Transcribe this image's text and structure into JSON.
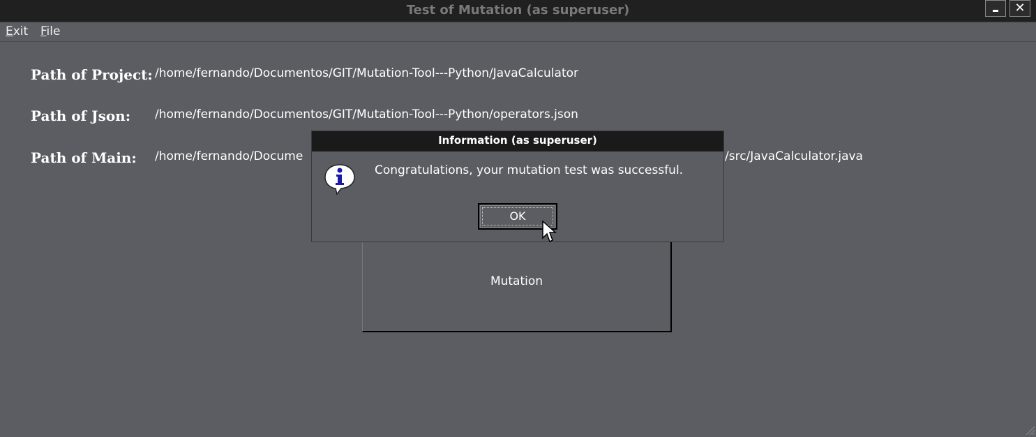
{
  "window": {
    "title": "Test of Mutation (as superuser)",
    "controls": {
      "minimize_icon": "minimize-icon",
      "close_label": "✕"
    }
  },
  "menubar": {
    "items": [
      {
        "label": "Exit",
        "mnemonic": "E"
      },
      {
        "label": "File",
        "mnemonic": "F"
      }
    ]
  },
  "paths": {
    "project": {
      "label": "Path of Project:",
      "value": "/home/fernando/Documentos/GIT/Mutation-Tool---Python/JavaCalculator"
    },
    "json": {
      "label": "Path of Json:",
      "value": "/home/fernando/Documentos/GIT/Mutation-Tool---Python/operators.json"
    },
    "main": {
      "label": "Path of Main:",
      "value_visible_start": "/home/fernando/Docume",
      "value_visible_end": "/src/JavaCalculator.java"
    }
  },
  "mutation_button": {
    "label": "Mutation"
  },
  "dialog": {
    "title": "Information (as superuser)",
    "icon": "info-icon",
    "message": "Congratulations, your mutation test was successful.",
    "ok_label": "OK"
  },
  "colors": {
    "background": "#5c5d62",
    "titlebar": "#202020",
    "title_text": "#7a7a7a",
    "dialog_titlebar": "#1a1a1a",
    "text": "#ffffff",
    "info_icon_blue": "#1a1aa8"
  }
}
